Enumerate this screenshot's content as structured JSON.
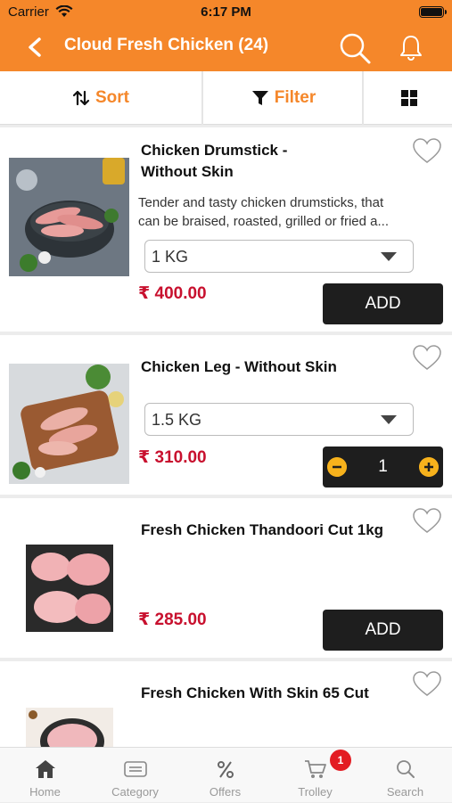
{
  "status_bar": {
    "carrier": "Carrier",
    "time": "6:17 PM"
  },
  "header": {
    "title": "Cloud Fresh Chicken (24)"
  },
  "toolbar": {
    "sort_label": "Sort",
    "filter_label": "Filter",
    "view_icon": "grid-icon"
  },
  "products": [
    {
      "name_line1": "Chicken Drumstick -",
      "name_line2": "Without Skin",
      "description_line1": "Tender and tasty chicken drumsticks, that",
      "description_line2": "can be braised, roasted, grilled or fried a...",
      "weight": "1 KG",
      "price": "₹ 400.00",
      "add_label": "ADD"
    },
    {
      "name": "Chicken Leg - Without Skin",
      "weight": "1.5 KG",
      "price": "₹ 310.00",
      "quantity": "1"
    },
    {
      "name": "Fresh Chicken Thandoori Cut 1kg",
      "price": "₹ 285.00",
      "add_label": "ADD"
    },
    {
      "name": "Fresh Chicken With Skin 65 Cut"
    }
  ],
  "tabs": [
    {
      "label": "Home",
      "icon": "home-icon"
    },
    {
      "label": "Category",
      "icon": "category-icon"
    },
    {
      "label": "Offers",
      "icon": "percent-icon"
    },
    {
      "label": "Trolley",
      "icon": "cart-icon",
      "badge": "1"
    },
    {
      "label": "Search",
      "icon": "search-icon"
    }
  ],
  "colors": {
    "brand": "#f5872a",
    "price": "#c8102e",
    "button": "#1e1e1e",
    "stepper_accent": "#f7b21c",
    "badge": "#e31c23"
  }
}
